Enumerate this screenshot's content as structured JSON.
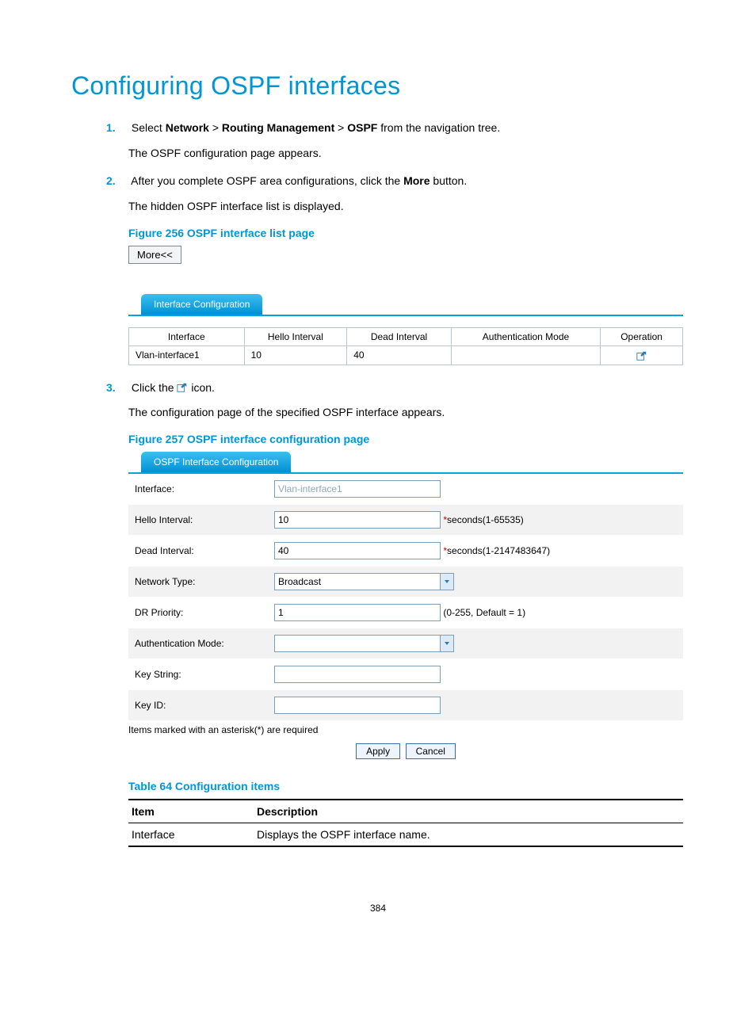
{
  "title": "Configuring OSPF interfaces",
  "steps": {
    "s1": {
      "num": "1.",
      "pre": "Select ",
      "path_a": "Network",
      "gt1": " > ",
      "path_b": "Routing Management",
      "gt2": " > ",
      "path_c": "OSPF",
      "post": " from the navigation tree.",
      "sub": "The OSPF configuration page appears."
    },
    "s2": {
      "num": "2.",
      "pre": "After you complete OSPF area configurations, click the ",
      "more": "More",
      "post": " button.",
      "sub": "The hidden OSPF interface list is displayed."
    },
    "s3": {
      "num": "3.",
      "pre": "Click the ",
      "post": " icon.",
      "sub": "The configuration page of the specified OSPF interface appears."
    }
  },
  "fig256": {
    "caption": "Figure 256 OSPF interface list page",
    "more_btn": "More<<",
    "tab": "Interface Configuration",
    "headers": {
      "interface": "Interface",
      "hello": "Hello Interval",
      "dead": "Dead Interval",
      "auth": "Authentication Mode",
      "op": "Operation"
    },
    "row": {
      "interface": "Vlan-interface1",
      "hello": "10",
      "dead": "40",
      "auth": ""
    }
  },
  "fig257": {
    "caption": "Figure 257 OSPF interface configuration page",
    "tab": "OSPF Interface Configuration",
    "labels": {
      "interface": "Interface:",
      "hello": "Hello Interval:",
      "dead": "Dead Interval:",
      "net": "Network Type:",
      "dr": "DR Priority:",
      "auth": "Authentication Mode:",
      "key": "Key String:",
      "keyid": "Key ID:"
    },
    "values": {
      "interface": "Vlan-interface1",
      "hello": "10",
      "dead": "40",
      "net": "Broadcast",
      "dr": "1",
      "auth": "",
      "key": "",
      "keyid": ""
    },
    "hints": {
      "hello": "seconds(1-65535)",
      "dead": "seconds(1-2147483647)",
      "dr": "(0-255, Default = 1)"
    },
    "req_note": "Items marked with an asterisk(*) are required",
    "apply": "Apply",
    "cancel": "Cancel"
  },
  "table64": {
    "caption": "Table 64 Configuration items",
    "h1": "Item",
    "h2": "Description",
    "r1c1": "Interface",
    "r1c2": "Displays the OSPF interface name."
  },
  "page_number": "384"
}
